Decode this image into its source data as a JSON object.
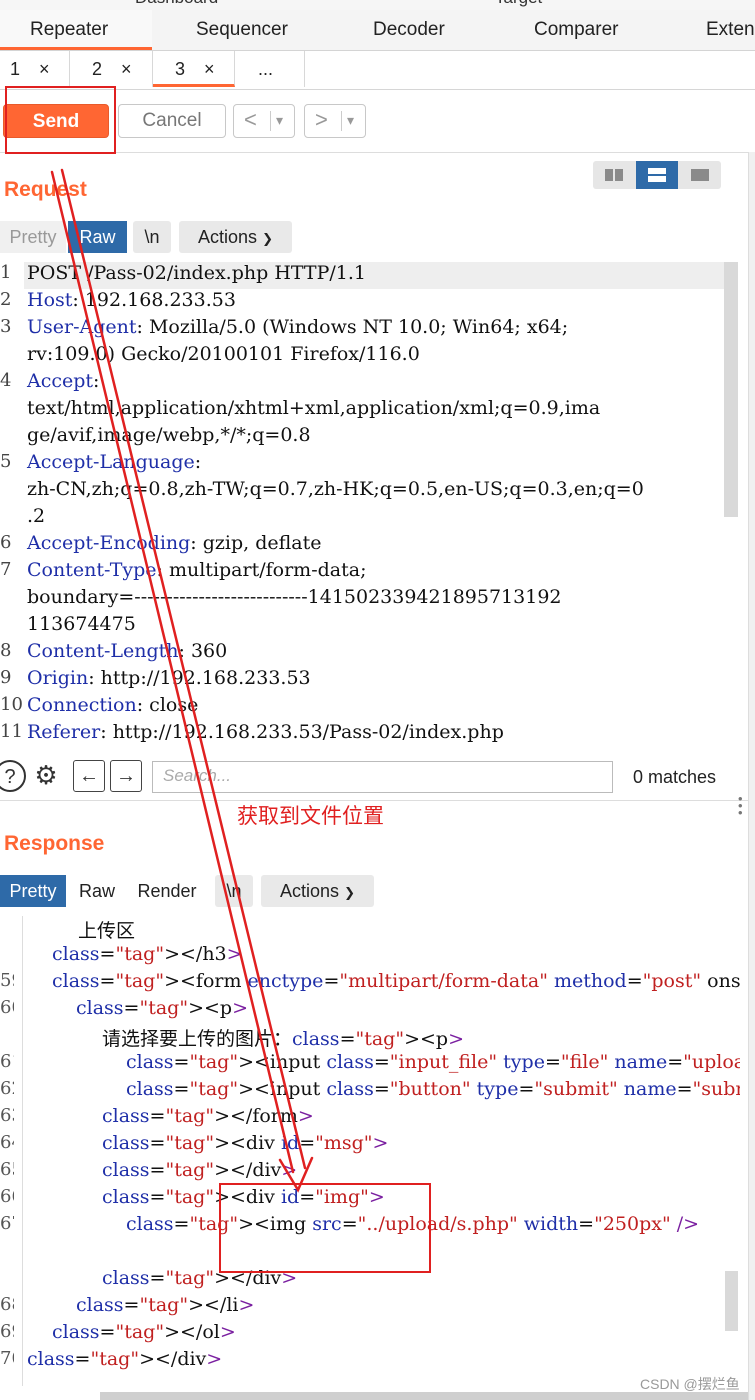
{
  "top_strip": {
    "left": "Dashboard",
    "right": "Target"
  },
  "main_tabs": [
    "Repeater",
    "Sequencer",
    "Decoder",
    "Comparer",
    "Exten"
  ],
  "sub_tabs": [
    {
      "label": "1",
      "close": "×"
    },
    {
      "label": "2",
      "close": "×"
    },
    {
      "label": "3",
      "close": "×"
    },
    {
      "label": "..."
    }
  ],
  "toolbar": {
    "send": "Send",
    "cancel": "Cancel",
    "prev": "<",
    "next": ">",
    "dropdown": "▾"
  },
  "request": {
    "title": "Request",
    "tabs": [
      "Pretty",
      "Raw",
      "\\n",
      "Actions"
    ],
    "active_tab": "Raw",
    "line_numbers": [
      "1",
      "2",
      "3",
      "",
      "4",
      "",
      "",
      "5",
      "",
      "",
      "6",
      "7",
      "",
      "",
      "8",
      "9",
      "10",
      "11"
    ],
    "lines": [
      "POST /Pass-02/index.php HTTP/1.1",
      "Host: 192.168.233.53",
      "User-Agent: Mozilla/5.0 (Windows NT 10.0; Win64; x64;",
      "rv:109.0) Gecko/20100101 Firefox/116.0",
      "Accept:",
      "text/html,application/xhtml+xml,application/xml;q=0.9,ima",
      "ge/avif,image/webp,*/*;q=0.8",
      "Accept-Language:",
      "zh-CN,zh;q=0.8,zh-TW;q=0.7,zh-HK;q=0.5,en-US;q=0.3,en;q=0",
      ".2",
      "Accept-Encoding: gzip, deflate",
      "Content-Type: multipart/form-data;",
      "boundary=---------------------------141502339421895713192",
      "113674475",
      "Content-Length: 360",
      "Origin: http://192.168.233.53",
      "Connection: close",
      "Referer: http://192.168.233.53/Pass-02/index.php"
    ]
  },
  "search": {
    "placeholder": "Search...",
    "matches": "0 matches"
  },
  "annotation_text": "获取到文件位置",
  "response": {
    "title": "Response",
    "tabs": [
      "Pretty",
      "Raw",
      "Render",
      "\\n",
      "Actions"
    ],
    "active_tab": "Pretty",
    "line_numbers": [
      "",
      "",
      "59",
      "60",
      "",
      "61",
      "62",
      "63",
      "64",
      "65",
      "66",
      "67",
      "",
      "",
      "68",
      "69",
      "70"
    ],
    "lines": [
      "上传区",
      "</h3>",
      "<form enctype=\"multipart/form-data\" method=\"post\" onsubm",
      "<p>",
      "请选择要上传的图片：<p>",
      "<input class=\"input_file\" type=\"file\" name=\"upload",
      "<input class=\"button\" type=\"submit\" name=\"submit\"",
      "</form>",
      "<div id=\"msg\">",
      "</div>",
      "<div id=\"img\">",
      "<img src=\"../upload/s.php\" width=\"250px\" />",
      "",
      "</div>",
      "</li>",
      "</ol>",
      "</div>"
    ]
  },
  "watermark": "CSDN @摆烂鱼",
  "colors": {
    "accent": "#ff6633",
    "active_tab": "#2e6aa8",
    "annotation": "#e02020"
  }
}
